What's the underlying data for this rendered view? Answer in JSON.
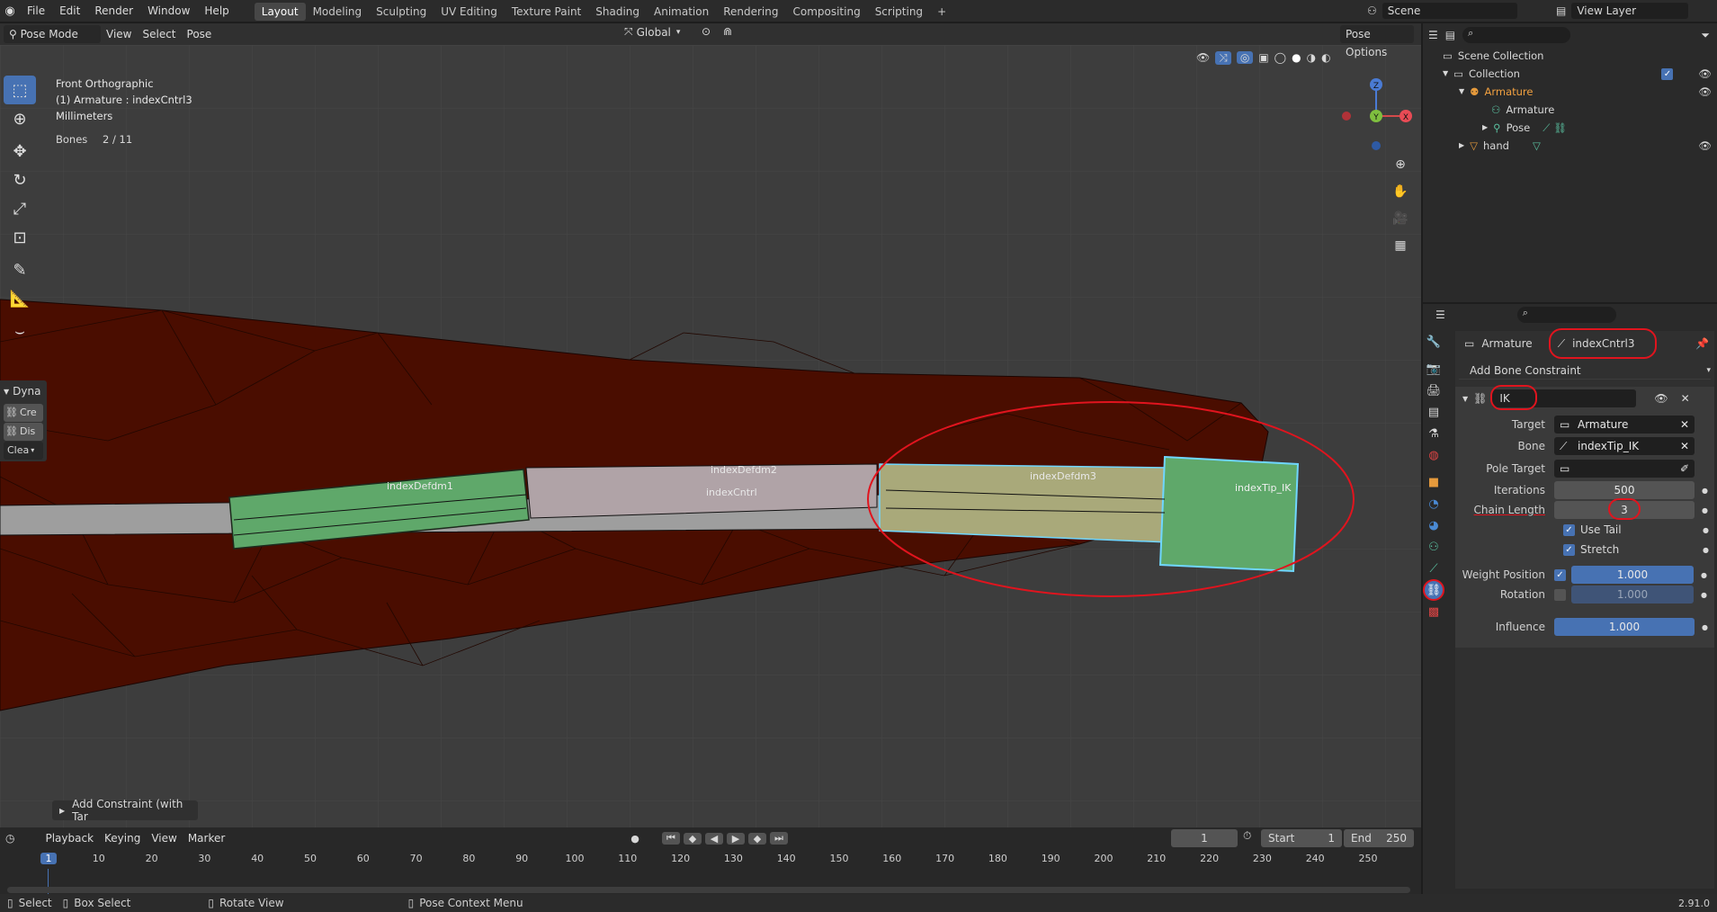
{
  "topbar": {
    "menus": [
      "File",
      "Edit",
      "Render",
      "Window",
      "Help"
    ],
    "workspaces": [
      "Layout",
      "Modeling",
      "Sculpting",
      "UV Editing",
      "Texture Paint",
      "Shading",
      "Animation",
      "Rendering",
      "Compositing",
      "Scripting"
    ],
    "active_workspace": "Layout",
    "scene": "Scene",
    "view_layer": "View Layer"
  },
  "viewport": {
    "mode": "Pose Mode",
    "menus": [
      "View",
      "Select",
      "Pose"
    ],
    "transform_orientation": "Global",
    "pose_options": "Pose Options",
    "info_line1": "Front Orthographic",
    "info_line2": "(1) Armature : indexCntrl3",
    "info_line3": "Millimeters",
    "bones_label": "Bones",
    "bones_value": "2 / 11",
    "bone_labels": [
      "indexDefdm1",
      "indexDefdm2",
      "indexCntrl",
      "indexDefdm3",
      "indexTip_IK"
    ],
    "dyna_panel": {
      "title": "Dyna",
      "items": [
        "Cre",
        "Dis",
        "Clea"
      ]
    },
    "last_op": "Add Constraint (with Tar",
    "gizmo": {
      "z": "Z",
      "y": "Y",
      "x": "X"
    }
  },
  "timeline": {
    "menus": [
      "Playback",
      "Keying",
      "View",
      "Marker"
    ],
    "current_frame": "1",
    "start_label": "Start",
    "start": "1",
    "end_label": "End",
    "end": "250",
    "ruler": [
      "1",
      "10",
      "20",
      "30",
      "40",
      "50",
      "60",
      "70",
      "80",
      "90",
      "100",
      "110",
      "120",
      "130",
      "140",
      "150",
      "160",
      "170",
      "180",
      "190",
      "200",
      "210",
      "220",
      "230",
      "240",
      "250"
    ]
  },
  "statusbar": {
    "select": "Select",
    "box_select": "Box Select",
    "rotate_view": "Rotate View",
    "context_menu": "Pose Context Menu",
    "version": "2.91.0"
  },
  "outliner": {
    "scene_collection": "Scene Collection",
    "collection": "Collection",
    "armature_obj": "Armature",
    "armature_data": "Armature",
    "pose": "Pose",
    "hand": "hand"
  },
  "properties": {
    "breadcrumb_obj": "Armature",
    "breadcrumb_bone": "indexCntrl3",
    "add_constraint": "Add Bone Constraint",
    "constraint_name": "IK",
    "target_label": "Target",
    "target_value": "Armature",
    "bone_label": "Bone",
    "bone_value": "indexTip_IK",
    "pole_label": "Pole Target",
    "iterations_label": "Iterations",
    "iterations_value": "500",
    "chain_label": "Chain Length",
    "chain_value": "3",
    "use_tail": "Use Tail",
    "stretch": "Stretch",
    "weight_position_label": "Weight Position",
    "weight_position_value": "1.000",
    "rotation_label": "Rotation",
    "rotation_value": "1.000",
    "influence_label": "Influence",
    "influence_value": "1.000"
  },
  "colors": {
    "accent": "#4772b3",
    "annotation": "#e0141e",
    "mesh": "#4a0d00",
    "bone_selected": "#5fa86a",
    "bone_active": "#8fbfa0"
  }
}
